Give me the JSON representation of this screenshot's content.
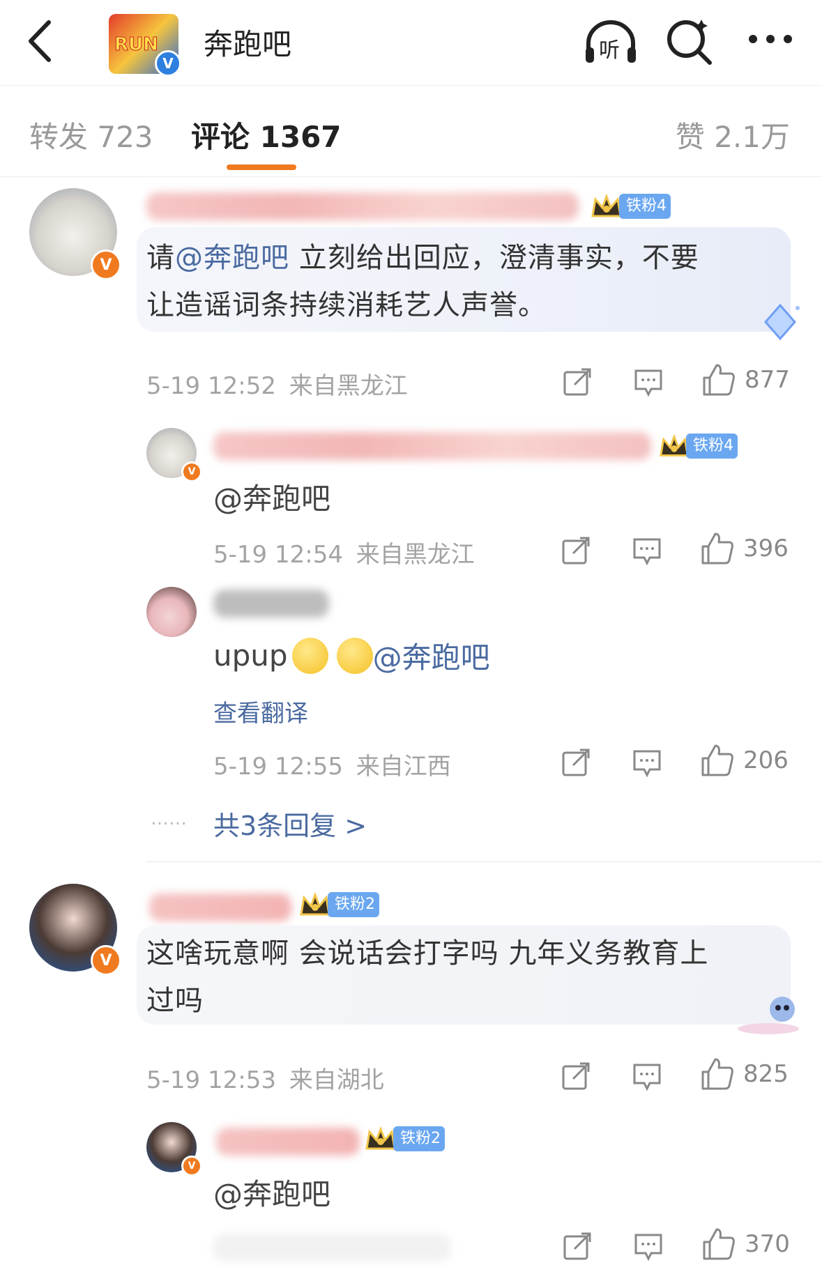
{
  "header": {
    "title": "奔跑吧",
    "listen_label": "听"
  },
  "tabs": {
    "repost": "转发 723",
    "comments": "评论 1367",
    "likes": "赞 2.1万"
  },
  "colors": {
    "accent": "#f07a1f",
    "link": "#4a6aa0",
    "badge": "#6aa7f0"
  },
  "comments": [
    {
      "badge": "铁粉4",
      "prefix": "请",
      "mention": "@奔跑吧",
      "text_rest": " 立刻给出回应，澄清事实，不要",
      "text_line2": "让造谣词条持续消耗艺人声誉。",
      "time": "5-19 12:52",
      "location": "来自黑龙江",
      "likes": "877",
      "replies": [
        {
          "badge": "铁粉4",
          "text": "@奔跑吧",
          "time": "5-19 12:54",
          "location": "来自黑龙江",
          "likes": "396"
        },
        {
          "text_prefix": "upup",
          "mention": "@奔跑吧",
          "translate": "查看翻译",
          "time": "5-19 12:55",
          "location": "来自江西",
          "likes": "206"
        }
      ],
      "more_dots": "……",
      "more_replies": "共3条回复 >"
    },
    {
      "badge": "铁粉2",
      "text_line1": "这啥玩意啊 会说话会打字吗 九年义务教育上",
      "text_line2": "过吗",
      "time": "5-19 12:53",
      "location": "来自湖北",
      "likes": "825",
      "replies": [
        {
          "badge": "铁粉2",
          "text": "@奔跑吧",
          "likes": "370"
        }
      ]
    }
  ]
}
